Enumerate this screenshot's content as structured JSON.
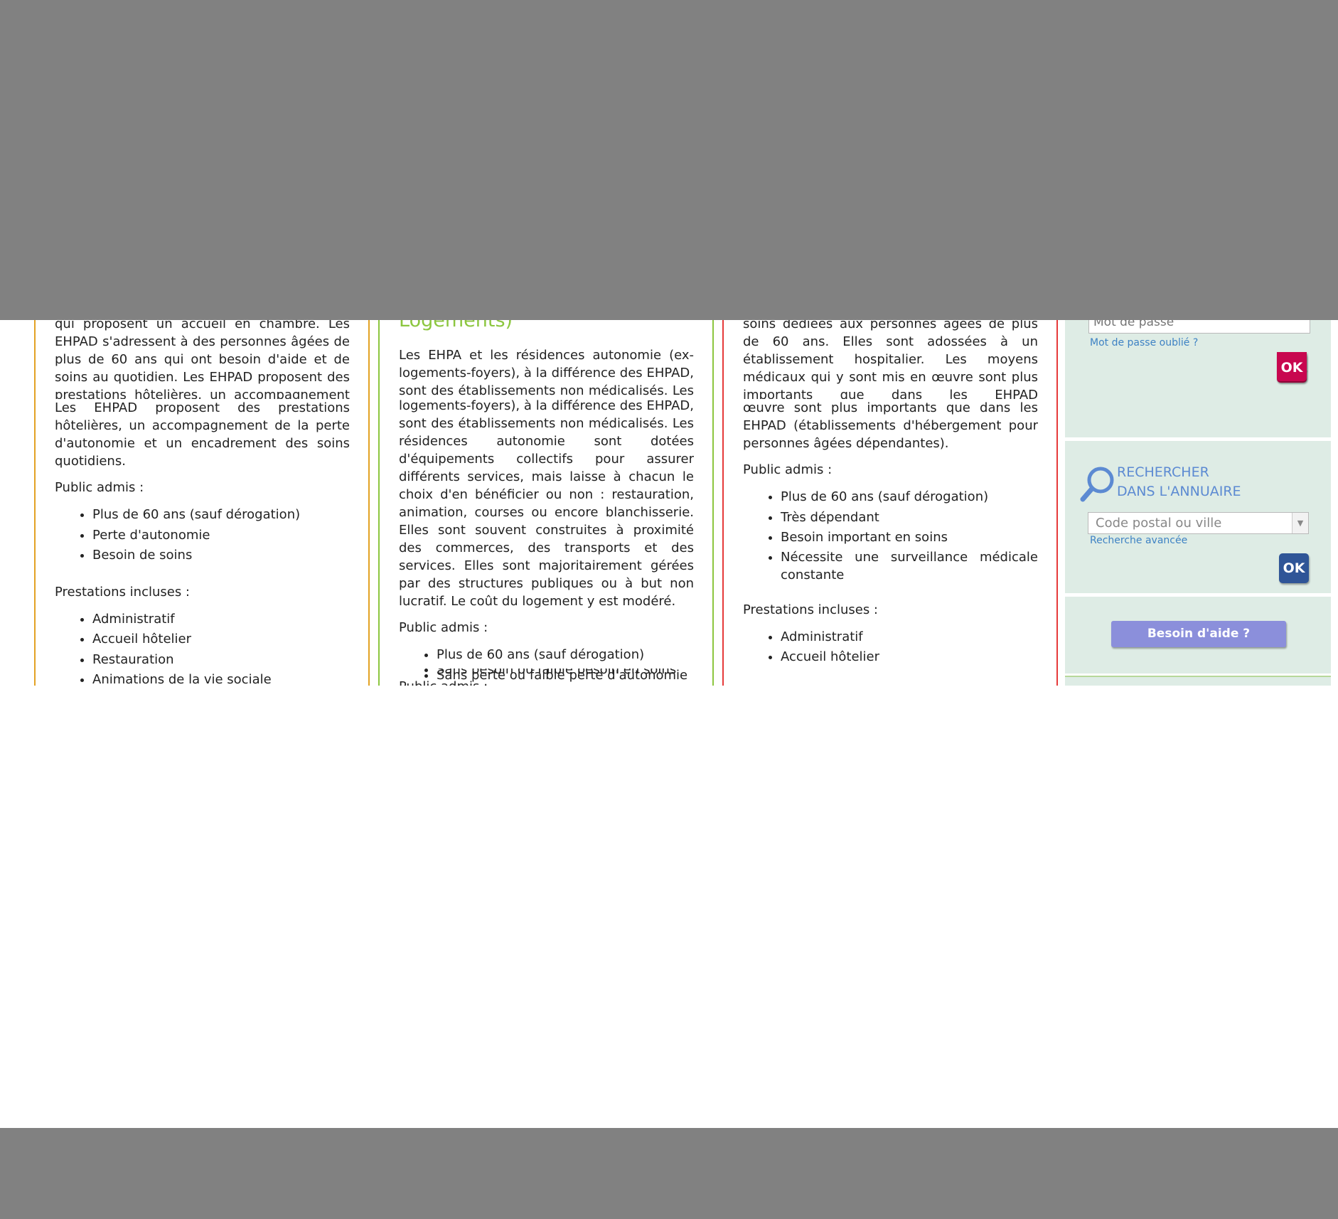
{
  "col1": {
    "frag_a": "qui proposent un accueil en chambre. Les EHPAD s'adressent à des personnes âgées de plus de 60 ans qui ont besoin d'aide et de soins au quotidien. Les EHPAD proposent des prestations hôtelières, un accompagnement de la perte d'autonomie et un",
    "frag_b": "Les EHPAD proposent des prestations hôtelières, un accompagnement de la perte d'autonomie et un encadrement des soins quotidiens.",
    "public_label": "Public admis :",
    "public_items": [
      "Plus de 60 ans (sauf dérogation)",
      "Perte d'autonomie",
      "Besoin de soins"
    ],
    "prestations_label": "Prestations incluses :",
    "prestations_items": [
      "Administratif",
      "Accueil hôtelier",
      "Restauration",
      "Animations de la vie sociale"
    ]
  },
  "col2": {
    "heading_tail": "Logements)",
    "frag_a": "Les EHPA et les résidences autonomie (ex-logements-foyers), à la différence des EHPAD, sont des établissements non médicalisés. Les résidences",
    "frag_b": "logements-foyers), à la différence des EHPAD, sont des établissements non médicalisés. Les résidences autonomie sont dotées d'équipements collectifs pour assurer différents services, mais laisse à chacun le choix d'en bénéficier ou non : restauration, animation, courses ou encore blanchisserie. Elles sont souvent construites à proximité des commerces, des transports et des services. Elles sont majoritairement gérées par des structures publiques ou à but non lucratif. Le coût du logement y est modéré.",
    "public_label": "Public admis :",
    "public_items": [
      "Plus de 60 ans (sauf dérogation)",
      "Sans perte ou faible perte d'autonomie",
      "Sans besoin ou faible besoin en soins"
    ],
    "public_label_repeat": "Public admis :"
  },
  "col3": {
    "frag_a": "soins dédiées aux personnes âgées de plus de 60 ans. Elles sont adossées à un établissement hospitalier. Les moyens médicaux qui y sont mis en œuvre sont plus importants que dans les EHPAD (établissements d'hébergement pour personnes",
    "frag_b": "œuvre sont plus importants que dans les EHPAD (établissements d'hébergement pour personnes âgées dépendantes).",
    "public_label": "Public admis :",
    "public_items": [
      "Plus de 60 ans (sauf dérogation)",
      "Très dépendant",
      "Besoin important en soins",
      "Nécessite une surveillance médicale constante"
    ],
    "prestations_label": "Prestations incluses :",
    "prestations_items": [
      "Administratif",
      "Accueil hôtelier"
    ]
  },
  "sidebar": {
    "password_placeholder": "Mot de passe",
    "forgot_link": "Mot de passe oublié ?",
    "ok_label": "OK",
    "search_title_line1": "RECHERCHER",
    "search_title_line2": "DANS L'ANNUAIRE",
    "postal_placeholder": "Code postal ou ville",
    "advanced_link": "Recherche avancée",
    "help_button": "Besoin d'aide ?"
  },
  "colors": {
    "ehpad_border": "#e3a224",
    "residence_border": "#8cc63f",
    "usld_border": "#e63a3a",
    "pink_button": "#c8074f",
    "blue_button": "#2f5597",
    "help_button": "#8b8fdb",
    "sidebar_bg": "#deece5",
    "link": "#3e82c4"
  },
  "icons": {
    "search": "magnifier-icon",
    "dropdown": "chevron-down-icon"
  }
}
